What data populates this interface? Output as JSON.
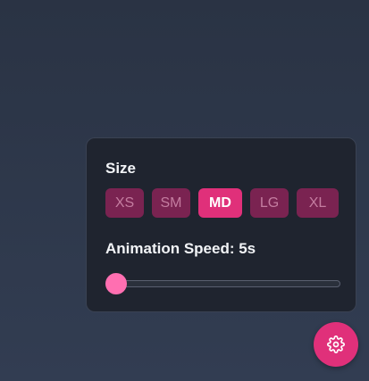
{
  "settings": {
    "size_label": "Size",
    "size_options": [
      "XS",
      "SM",
      "MD",
      "LG",
      "XL"
    ],
    "selected_size": "MD",
    "speed_label": "Animation Speed: 5s",
    "speed_value_seconds": 5,
    "speed_slider_fraction": 0.0
  },
  "colors": {
    "accent": "#e0307a",
    "inactive_button": "#7a2351",
    "slider_thumb": "#ff6fb1",
    "panel_bg": "#1f242f"
  },
  "fab": {
    "icon": "gear-icon"
  }
}
